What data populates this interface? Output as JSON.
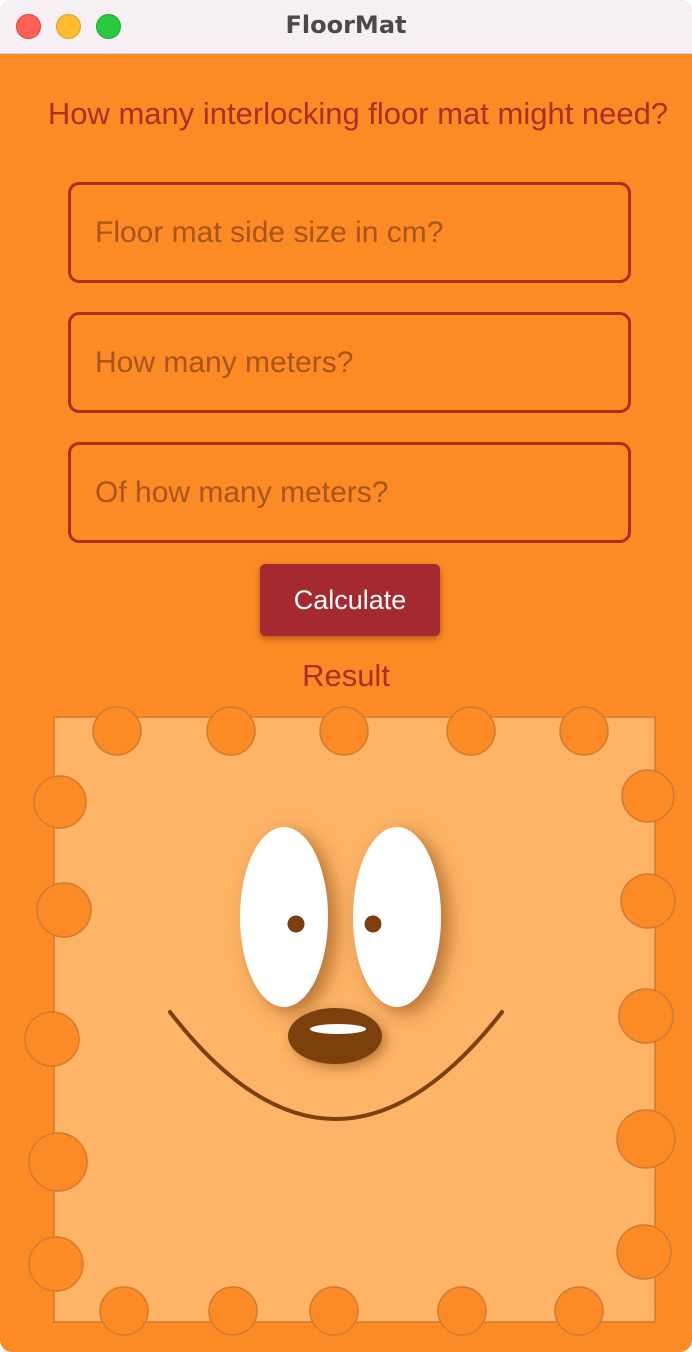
{
  "window": {
    "title": "FloorMat"
  },
  "form": {
    "question": "How many interlocking floor mat might need?",
    "fields": [
      {
        "placeholder": "Floor mat side size in cm?",
        "value": ""
      },
      {
        "placeholder": "How many meters?",
        "value": ""
      },
      {
        "placeholder": "Of how many meters?",
        "value": ""
      }
    ],
    "calculate_label": "Calculate",
    "result_label": "Result"
  },
  "illustration": {
    "icon": "smiling-floor-mat",
    "colors": {
      "background": "#fd8b25",
      "mat": "#fdb466",
      "face_brown": "#7b3f10",
      "accent_red": "#b22c22",
      "button": "#a42a2f"
    }
  }
}
